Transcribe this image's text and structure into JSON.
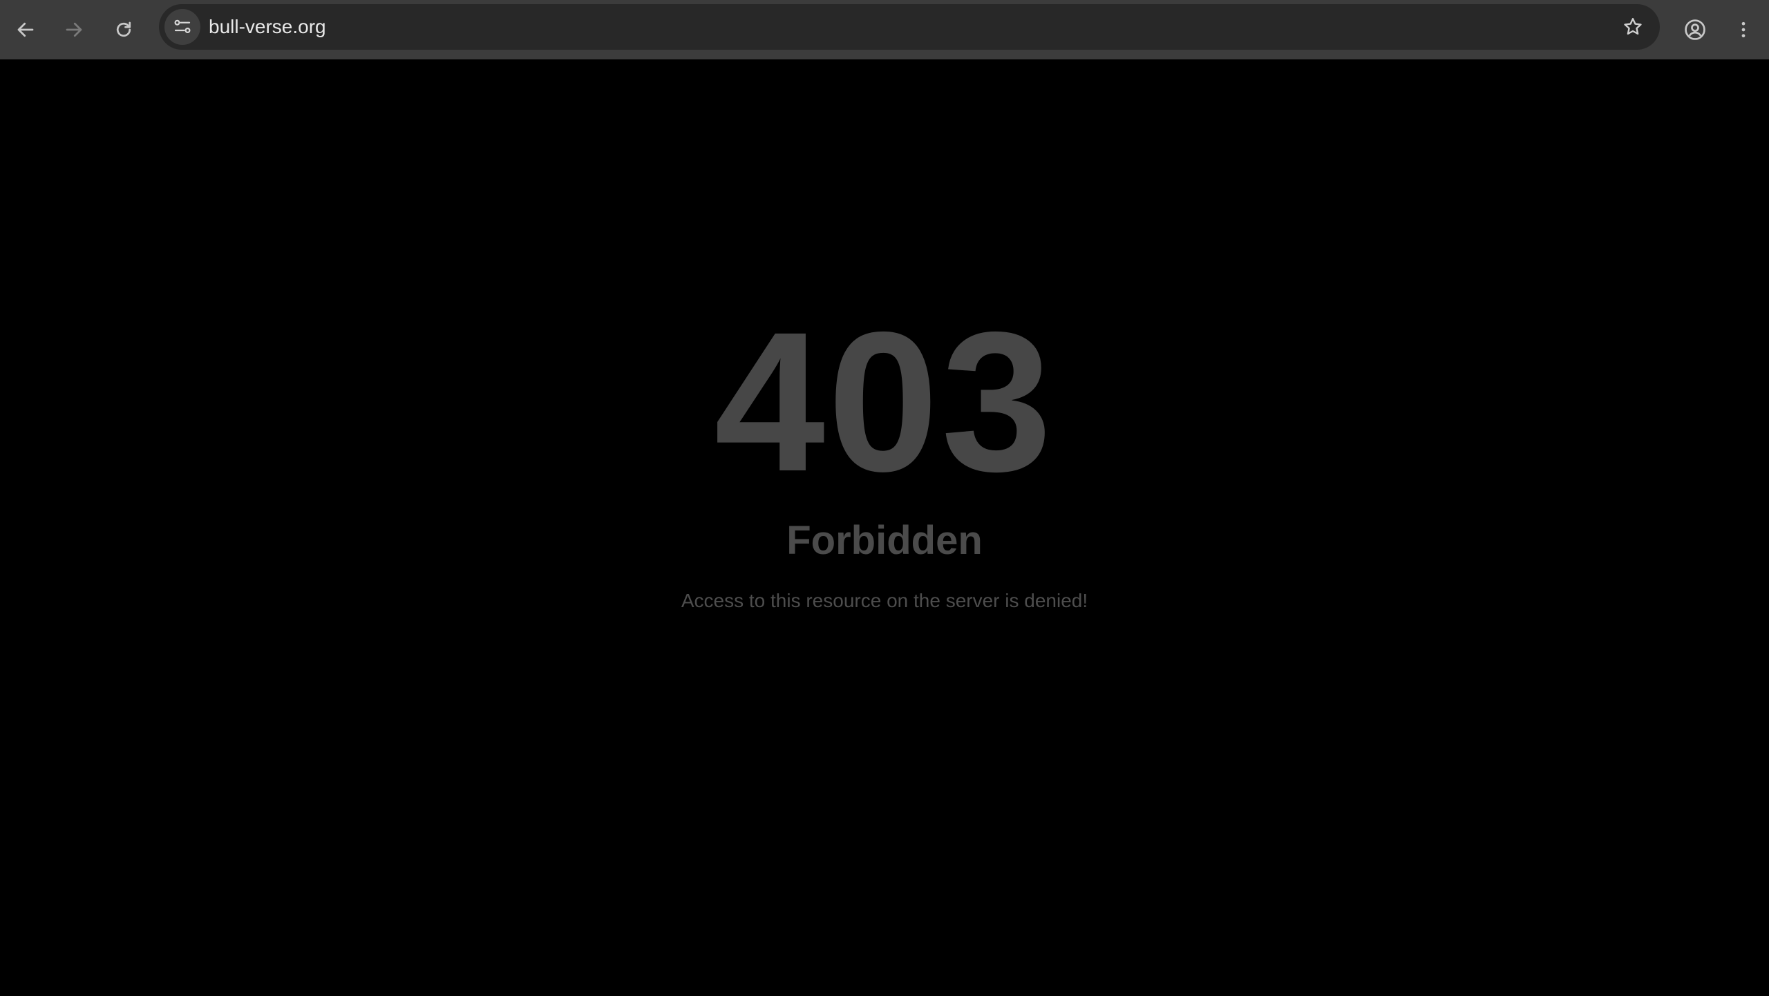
{
  "browser": {
    "url": "bull-verse.org",
    "icons": {
      "back": "back-arrow-icon",
      "forward": "forward-arrow-icon",
      "reload": "reload-icon",
      "site_info": "site-settings-icon",
      "bookmark": "star-icon",
      "profile": "profile-icon",
      "menu": "more-vertical-icon"
    },
    "colors": {
      "toolbar": "#3c3c3c",
      "omnibox": "#282828",
      "icon": "#c8c8c8",
      "icon_disabled": "#7a7a7a"
    }
  },
  "page": {
    "code": "403",
    "title": "Forbidden",
    "message": "Access to this resource on the server is denied!",
    "colors": {
      "background": "#000000",
      "text": "#474747"
    }
  }
}
